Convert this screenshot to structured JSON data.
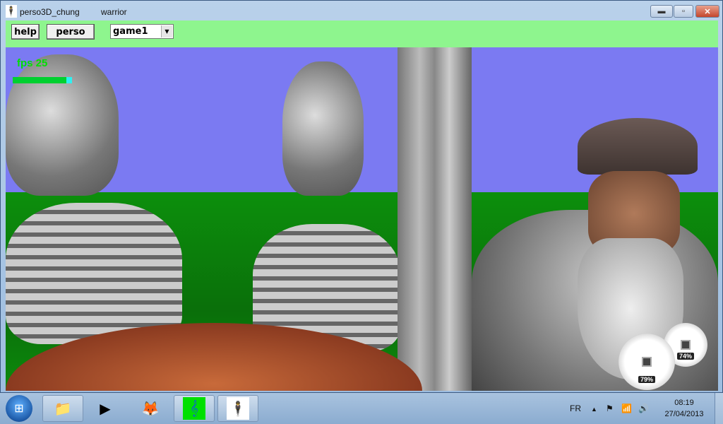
{
  "window": {
    "title": "perso3D_chung",
    "subtitle": "warrior",
    "minimize": "▬",
    "maximize": "▫",
    "close": "✕"
  },
  "toolbar": {
    "help_label": "help",
    "perso_label": "perso",
    "game_select_value": "game1"
  },
  "hud": {
    "fps_label": "fps 25",
    "fps_bar_fraction": 0.9
  },
  "gadget": {
    "cpu_percent": "79%",
    "memory_percent": "74%"
  },
  "taskbar": {
    "items": [
      {
        "name": "explorer",
        "icon": "📁"
      },
      {
        "name": "media-player",
        "icon": "▶"
      },
      {
        "name": "firefox",
        "icon": "🦊"
      },
      {
        "name": "music-app",
        "icon": "𝄞"
      },
      {
        "name": "perso3d",
        "icon": "🕴"
      }
    ],
    "tray": {
      "language": "FR",
      "show_hidden": "▲",
      "action_center": "⚑",
      "network": "📶",
      "volume": "🔊"
    },
    "clock": {
      "time": "08:19",
      "date": "27/04/2013"
    }
  },
  "colors": {
    "toolbar": "#8ef58e",
    "sky": "#7b7af2",
    "ground": "#0c8f0c",
    "fps": "#00e000"
  }
}
